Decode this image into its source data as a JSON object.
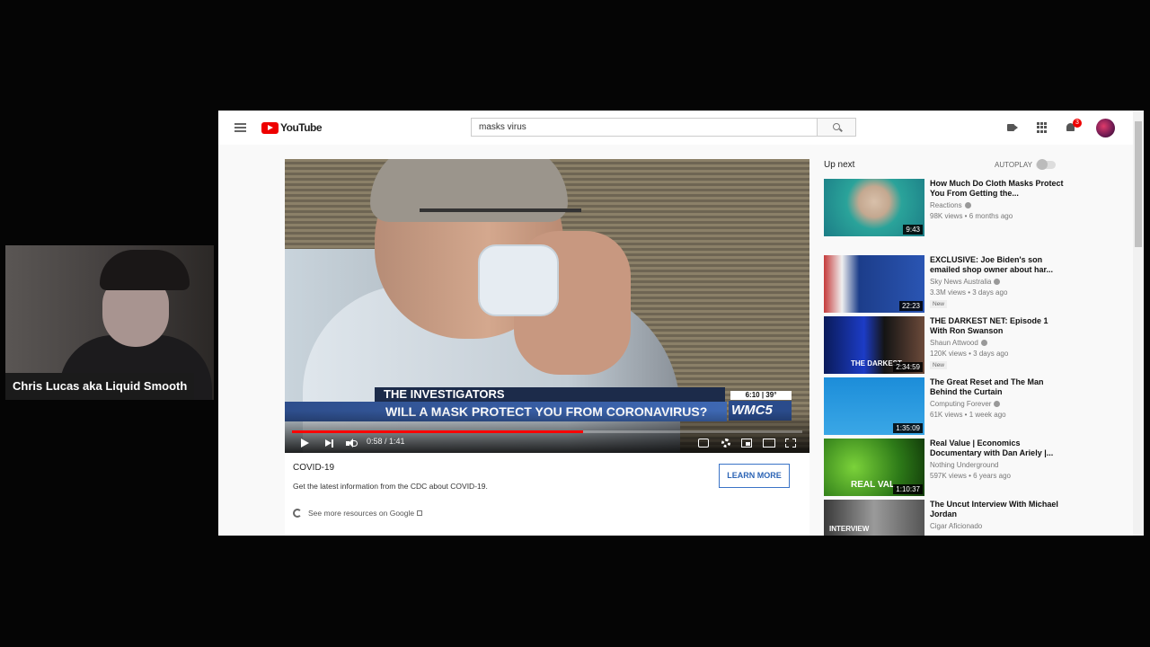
{
  "webcam": {
    "name": "Chris Lucas aka Liquid Smooth"
  },
  "header": {
    "logo_text": "YouTube",
    "search_value": "masks virus",
    "notification_count": "3",
    "icons": [
      "menu-icon",
      "search-icon",
      "upload-icon",
      "apps-icon",
      "bell-icon",
      "avatar"
    ]
  },
  "player": {
    "lower_third": "THE INVESTIGATORS",
    "headline": "WILL A MASK PROTECT YOU FROM CORONAVIRUS?",
    "station_time": "6:10 | 39°",
    "station_logo": "WMC5",
    "current_time": "0:58 / 1:41",
    "progress_fraction": 0.57,
    "accent": "#ff0000"
  },
  "info_card": {
    "title": "COVID-19",
    "description": "Get the latest information from the CDC about COVID-19.",
    "button": "LEARN MORE",
    "google_link": "See more resources on Google"
  },
  "sidebar": {
    "up_next": "Up next",
    "autoplay": "AUTOPLAY",
    "videos": [
      {
        "title": "How Much Do Cloth Masks Protect You From Getting the...",
        "channel": "Reactions",
        "meta": "98K views • 6 months ago",
        "duration": "9:43",
        "badge": ""
      },
      {
        "title": "EXCLUSIVE: Joe Biden's son emailed shop owner about har...",
        "channel": "Sky News Australia",
        "meta": "3.3M views • 3 days ago",
        "duration": "22:23",
        "badge": "New"
      },
      {
        "title": "THE DARKEST NET: Episode 1 With Ron Swanson",
        "channel": "Shaun Attwood",
        "meta": "120K views • 3 days ago",
        "duration": "2:34:59",
        "badge": "New"
      },
      {
        "title": "The Great Reset and The Man Behind the Curtain",
        "channel": "Computing Forever",
        "meta": "61K views • 1 week ago",
        "duration": "1:35:09",
        "badge": ""
      },
      {
        "title": "Real Value | Economics Documentary with Dan Ariely |...",
        "channel": "Nothing Underground",
        "meta": "597K views • 6 years ago",
        "duration": "1:10:37",
        "badge": ""
      },
      {
        "title": "The Uncut Interview With Michael Jordan",
        "channel": "Cigar Aficionado",
        "meta": "",
        "duration": "",
        "badge": ""
      }
    ],
    "thumb_texts": [
      "THE DARKEST",
      "REAL VAL",
      "INTERVIEW"
    ]
  }
}
